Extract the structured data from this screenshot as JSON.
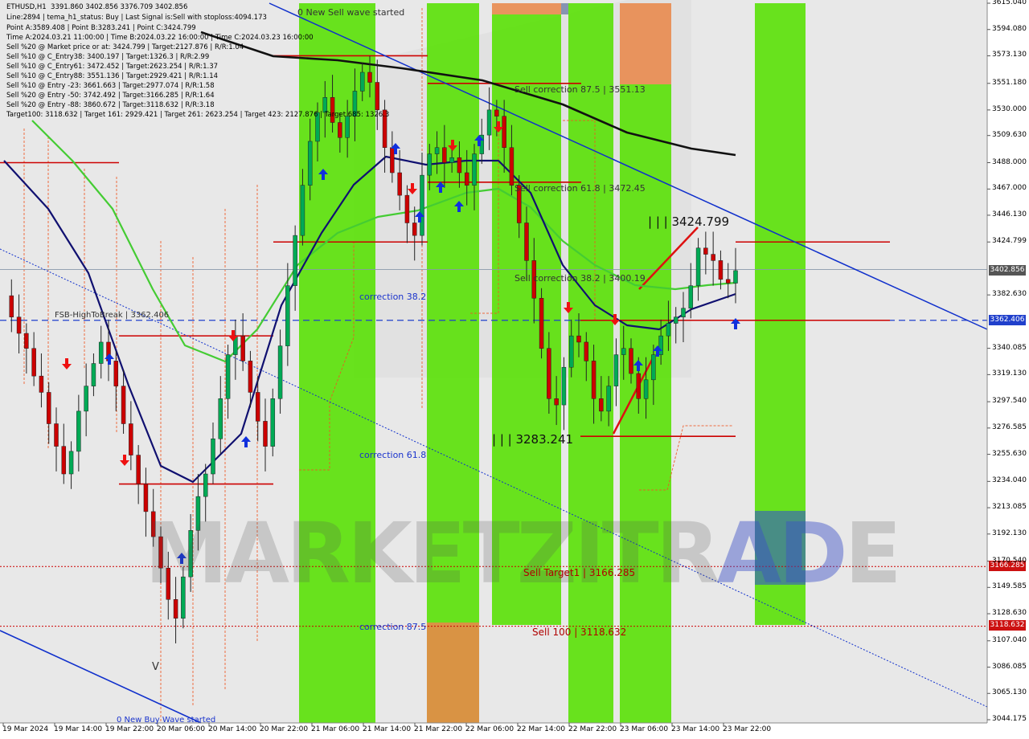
{
  "header": {
    "symbol": "ETHUSD,H1",
    "ohlc": "3391.860 3402.856 3376.709 3402.856",
    "lines": [
      "Line:2894 | tema_h1_status: Buy | Last Signal is:Sell with stoploss:4094.173",
      "Point A:3589.408 | Point B:3283.241 | Point C:3424.799",
      "Time A:2024.03.21 11:00:00 | Time B:2024.03.22 16:00:00 | Time C:2024.03.23 16:00:00",
      "Sell %20 @ Market price or at: 3424.799 | Target:2127.876 | R/R:1.04",
      "Sell %10 @ C_Entry38: 3400.197 | Target:1326.3 | R/R:2.99",
      "Sell %10 @ C_Entry61: 3472.452 | Target:2623.254 | R/R:1.37",
      "Sell %10 @ C_Entry88: 3551.136 | Target:2929.421 | R/R:1.14",
      "Sell %10 @ Entry -23: 3661.663 | Target:2977.074 | R/R:1.58",
      "Sell %20 @ Entry -50: 3742.492 | Target:3166.285 | R/R:1.64",
      "Sell %20 @ Entry -88: 3860.672 | Target:3118.632 | R/R:3.18",
      "Target100: 3118.632 | Target 161: 2929.421 | Target 261: 2623.254 | Target 423: 2127.876 | Target 685: 1326.3"
    ]
  },
  "annotations": {
    "new_sell_wave": "0 New Sell wave started",
    "new_buy_wave": "0 New Buy Wave started",
    "sell_corr_875": "Sell correction 87.5 | 3551.13",
    "sell_corr_618": "Sell correction 61.8 | 3472.45",
    "sell_corr_382": "Sell correction 38.2 | 3400.19",
    "point_c": "| | | 3424.799",
    "point_b": "| | | 3283.241",
    "correction_382": "correction 38.2",
    "correction_618": "correction 61.8",
    "correction_875": "correction 87.5",
    "fsb": "FSB-HighToBreak | 3362.406",
    "sell_target1": "Sell Target1 | 3166.285",
    "sell_100": "Sell 100 | 3118.632",
    "v_mark": "V"
  },
  "watermark": {
    "main": "MARKETZI",
    "trade": "TR",
    "ad": "AD",
    "e": "E"
  },
  "price_tags": {
    "current": "3402.856",
    "fsb": "3362.406",
    "target1": "3166.285",
    "target100": "3118.632"
  },
  "colors": {
    "bull": "#00aa55",
    "bear": "#cc0000",
    "green_zone": "#55e000",
    "orange_zone": "#e8884a",
    "trend_line": "#1030cc",
    "ma_dark": "#111111",
    "ma_navy": "#101070",
    "ma_green": "#44cc33",
    "level_red": "#cc0000",
    "envelope": "#ee5522"
  },
  "chart_data": {
    "type": "candlestick",
    "symbol": "ETHUSD",
    "timeframe": "H1",
    "ylim": [
      3044.175,
      3615.04
    ],
    "price_ticks": [
      "3615.040",
      "3594.080",
      "3573.130",
      "3551.180",
      "3530.000",
      "3509.630",
      "3488.000",
      "3467.000",
      "3446.130",
      "3424.799",
      "3402.856",
      "3382.630",
      "3362.406",
      "3340.085",
      "3319.130",
      "3297.540",
      "3276.585",
      "3255.630",
      "3234.040",
      "3213.085",
      "3192.130",
      "3170.540",
      "3166.285",
      "3149.585",
      "3128.630",
      "3118.632",
      "3107.040",
      "3086.085",
      "3065.130",
      "3044.175"
    ],
    "time_ticks": [
      "19 Mar 2024",
      "19 Mar 14:00",
      "19 Mar 22:00",
      "20 Mar 06:00",
      "20 Mar 14:00",
      "20 Mar 22:00",
      "21 Mar 06:00",
      "21 Mar 14:00",
      "21 Mar 22:00",
      "22 Mar 06:00",
      "22 Mar 14:00",
      "22 Mar 22:00",
      "23 Mar 06:00",
      "23 Mar 14:00",
      "23 Mar 22:00"
    ],
    "levels": [
      {
        "name": "FSB-HighToBreak",
        "value": 3362.406
      },
      {
        "name": "Sell Target1",
        "value": 3166.285
      },
      {
        "name": "Sell 100",
        "value": 3118.632
      },
      {
        "name": "Sell correction 87.5",
        "value": 3551.13
      },
      {
        "name": "Sell correction 61.8",
        "value": 3472.45
      },
      {
        "name": "Sell correction 38.2",
        "value": 3400.19
      },
      {
        "name": "Point A",
        "value": 3589.408
      },
      {
        "name": "Point B",
        "value": 3283.241
      },
      {
        "name": "Point C",
        "value": 3424.799
      }
    ],
    "close_path_h1": [
      3382,
      3365,
      3352,
      3340,
      3318,
      3305,
      3280,
      3262,
      3240,
      3258,
      3290,
      3310,
      3328,
      3345,
      3330,
      3310,
      3280,
      3255,
      3232,
      3210,
      3190,
      3165,
      3140,
      3125,
      3158,
      3195,
      3222,
      3240,
      3268,
      3300,
      3335,
      3350,
      3330,
      3305,
      3282,
      3262,
      3300,
      3342,
      3390,
      3430,
      3470,
      3505,
      3528,
      3540,
      3520,
      3508,
      3525,
      3545,
      3560,
      3552,
      3530,
      3500,
      3480,
      3462,
      3440,
      3430,
      3478,
      3495,
      3500,
      3488,
      3492,
      3480,
      3470,
      3495,
      3510,
      3530,
      3525,
      3500,
      3470,
      3440,
      3410,
      3380,
      3340,
      3300,
      3295,
      3325,
      3350,
      3345,
      3330,
      3300,
      3290,
      3310,
      3335,
      3340,
      3320,
      3300,
      3315,
      3335,
      3350,
      3360,
      3365,
      3372,
      3390,
      3420,
      3415,
      3410,
      3395,
      3392,
      3402
    ]
  }
}
